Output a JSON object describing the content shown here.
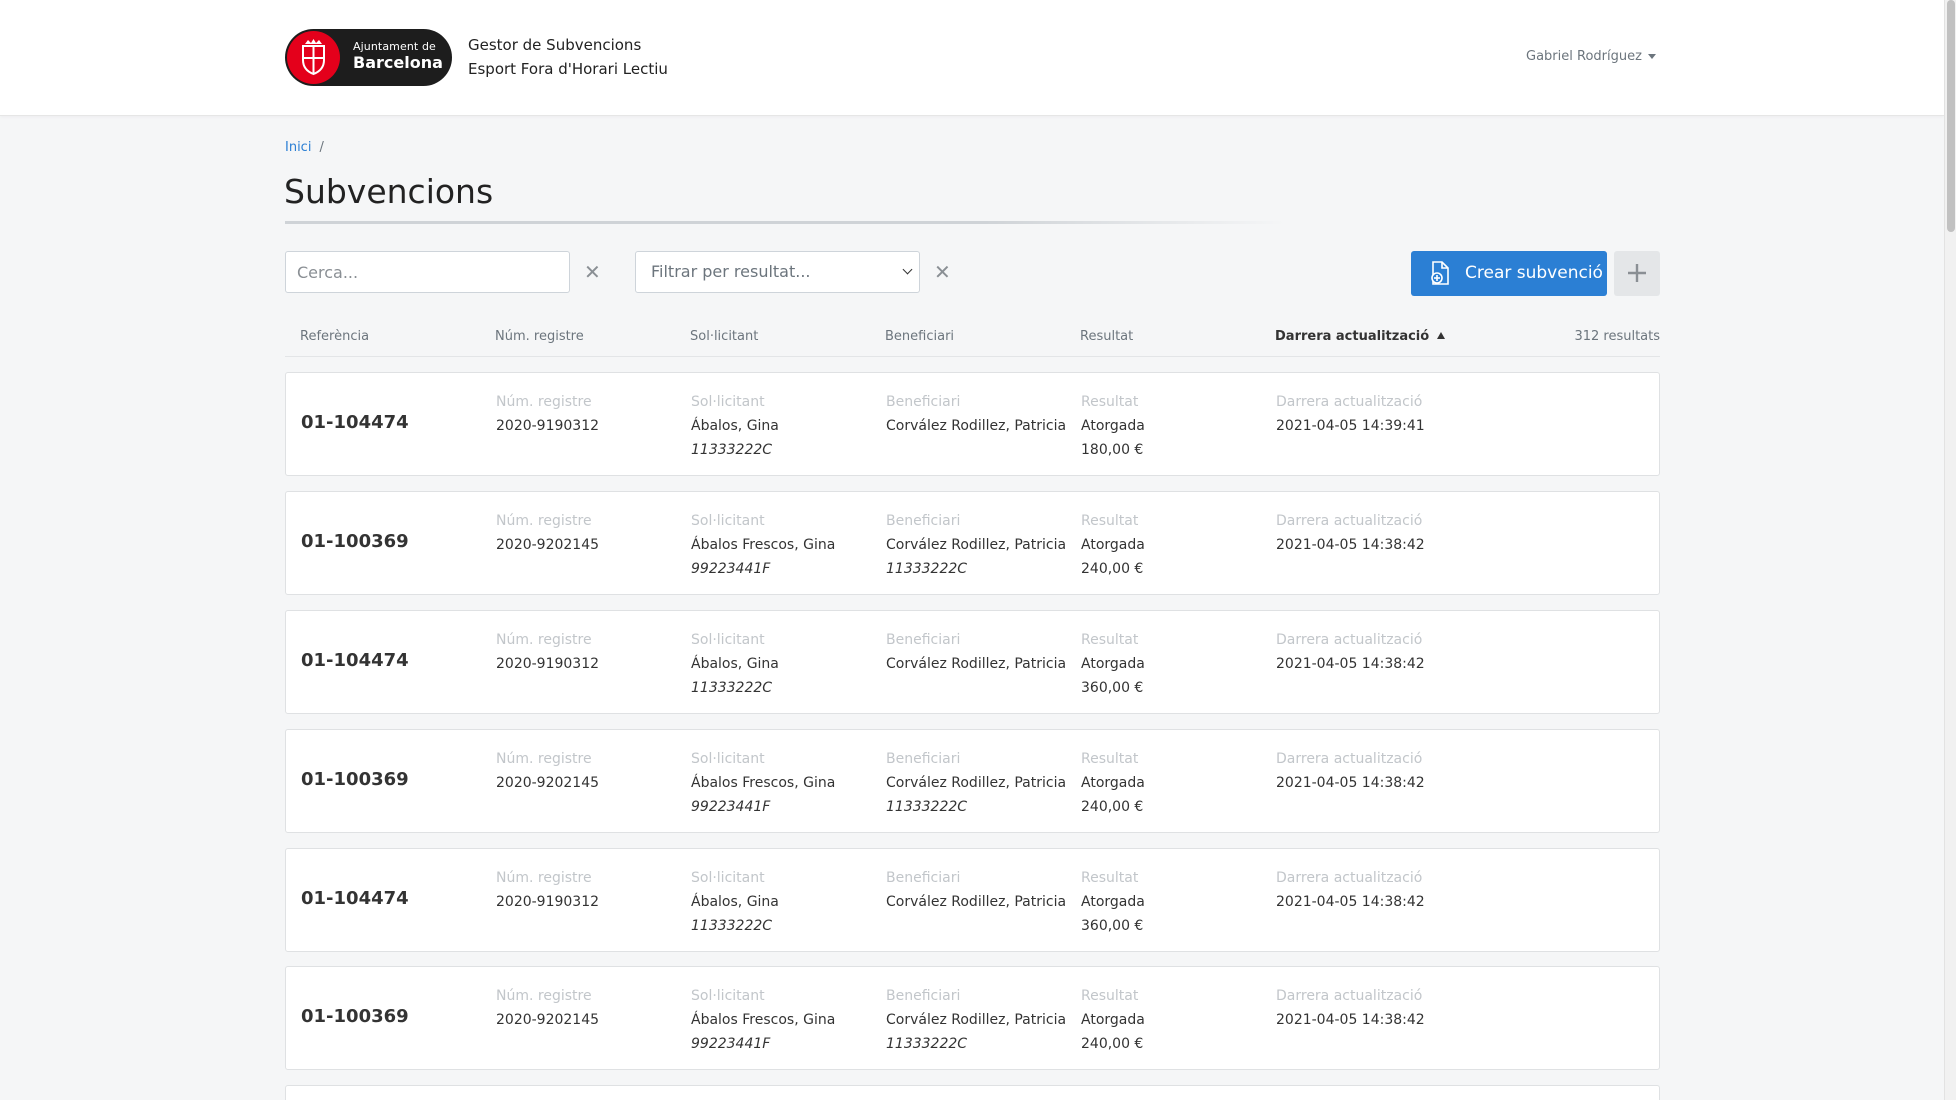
{
  "header": {
    "logo_top": "Ajuntament de",
    "logo_bottom": "Barcelona",
    "app_title_line1": "Gestor de Subvencions",
    "app_title_line2": "Esport Fora d'Horari Lectiu",
    "user_name": "Gabriel Rodríguez"
  },
  "breadcrumb": {
    "home": "Inici",
    "separator": "/"
  },
  "page_title": "Subvencions",
  "toolbar": {
    "search_placeholder": "Cerca...",
    "filter_placeholder": "Filtrar per resultat...",
    "clear_symbol": "✕",
    "create_label": "Crear subvenció",
    "accent_color": "#2b7fd4"
  },
  "table": {
    "headers": [
      "Referència",
      "Núm. registre",
      "Sol·licitant",
      "Beneficiari",
      "Resultat",
      "Darrera actualització"
    ],
    "sorted_column": "Darrera actualització",
    "result_count": "312 resultats",
    "rows": [
      {
        "ref": "01-104474",
        "reg": "2020-9190312",
        "sol_name": "Ábalos, Gina",
        "sol_id": "11333222C",
        "ben_name": "Corvález Rodillez, Patricia",
        "ben_id": "",
        "result": "Atorgada",
        "amount": "180,00 €",
        "updated": "2021-04-05 14:39:41"
      },
      {
        "ref": "01-100369",
        "reg": "2020-9202145",
        "sol_name": "Ábalos Frescos, Gina",
        "sol_id": "99223441F",
        "ben_name": "Corvález Rodillez, Patricia",
        "ben_id": "11333222C",
        "result": "Atorgada",
        "amount": "240,00 €",
        "updated": "2021-04-05 14:38:42"
      },
      {
        "ref": "01-104474",
        "reg": "2020-9190312",
        "sol_name": "Ábalos, Gina",
        "sol_id": "11333222C",
        "ben_name": "Corvález Rodillez, Patricia",
        "ben_id": "",
        "result": "Atorgada",
        "amount": "360,00 €",
        "updated": "2021-04-05 14:38:42"
      },
      {
        "ref": "01-100369",
        "reg": "2020-9202145",
        "sol_name": "Ábalos Frescos, Gina",
        "sol_id": "99223441F",
        "ben_name": "Corvález Rodillez, Patricia",
        "ben_id": "11333222C",
        "result": "Atorgada",
        "amount": "240,00 €",
        "updated": "2021-04-05 14:38:42"
      },
      {
        "ref": "01-104474",
        "reg": "2020-9190312",
        "sol_name": "Ábalos, Gina",
        "sol_id": "11333222C",
        "ben_name": "Corvález Rodillez, Patricia",
        "ben_id": "",
        "result": "Atorgada",
        "amount": "360,00 €",
        "updated": "2021-04-05 14:38:42"
      },
      {
        "ref": "01-100369",
        "reg": "2020-9202145",
        "sol_name": "Ábalos Frescos, Gina",
        "sol_id": "99223441F",
        "ben_name": "Corvález Rodillez, Patricia",
        "ben_id": "11333222C",
        "result": "Atorgada",
        "amount": "240,00 €",
        "updated": "2021-04-05 14:38:42"
      }
    ]
  }
}
